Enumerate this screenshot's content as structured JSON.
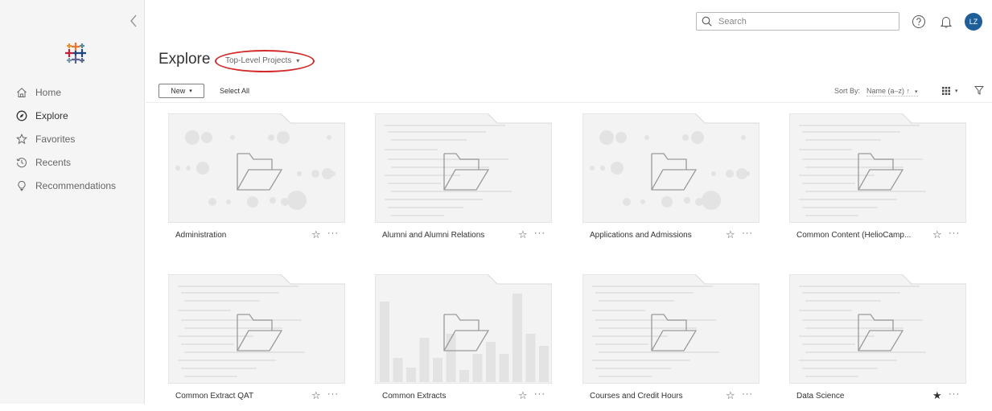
{
  "sidebar": {
    "items": [
      {
        "label": "Home",
        "icon": "home-icon",
        "active": false
      },
      {
        "label": "Explore",
        "icon": "compass-icon",
        "active": true
      },
      {
        "label": "Favorites",
        "icon": "star-icon",
        "active": false
      },
      {
        "label": "Recents",
        "icon": "history-icon",
        "active": false
      },
      {
        "label": "Recommendations",
        "icon": "lightbulb-icon",
        "active": false
      }
    ]
  },
  "header": {
    "search_placeholder": "Search",
    "user_initials": "LZ"
  },
  "page": {
    "title": "Explore",
    "project_filter": "Top-Level Projects"
  },
  "toolbar": {
    "new_label": "New",
    "select_all_label": "Select All",
    "sort_by_label": "Sort By:",
    "sort_value": "Name (a–z) ↑"
  },
  "projects": [
    {
      "name": "Administration",
      "thumb": "circles",
      "favorite": false
    },
    {
      "name": "Alumni and Alumni Relations",
      "thumb": "lines",
      "favorite": false
    },
    {
      "name": "Applications and Admissions",
      "thumb": "circles",
      "favorite": false
    },
    {
      "name": "Common Content (HelioCamp...",
      "thumb": "lines",
      "favorite": false
    },
    {
      "name": "Common Extract QAT",
      "thumb": "lines",
      "favorite": false
    },
    {
      "name": "Common Extracts",
      "thumb": "bars",
      "favorite": false
    },
    {
      "name": "Courses and Credit Hours",
      "thumb": "lines",
      "favorite": false
    },
    {
      "name": "Data Science",
      "thumb": "lines",
      "favorite": true
    }
  ],
  "colors": {
    "avatar": "#1f5f99",
    "highlight": "#d22a2a",
    "thumb_fill": "#f3f3f3",
    "thumb_shape": "#e3e3e3"
  },
  "glyphs": {
    "caret": "▾",
    "star_empty": "☆",
    "star_filled": "★",
    "more": "···"
  }
}
